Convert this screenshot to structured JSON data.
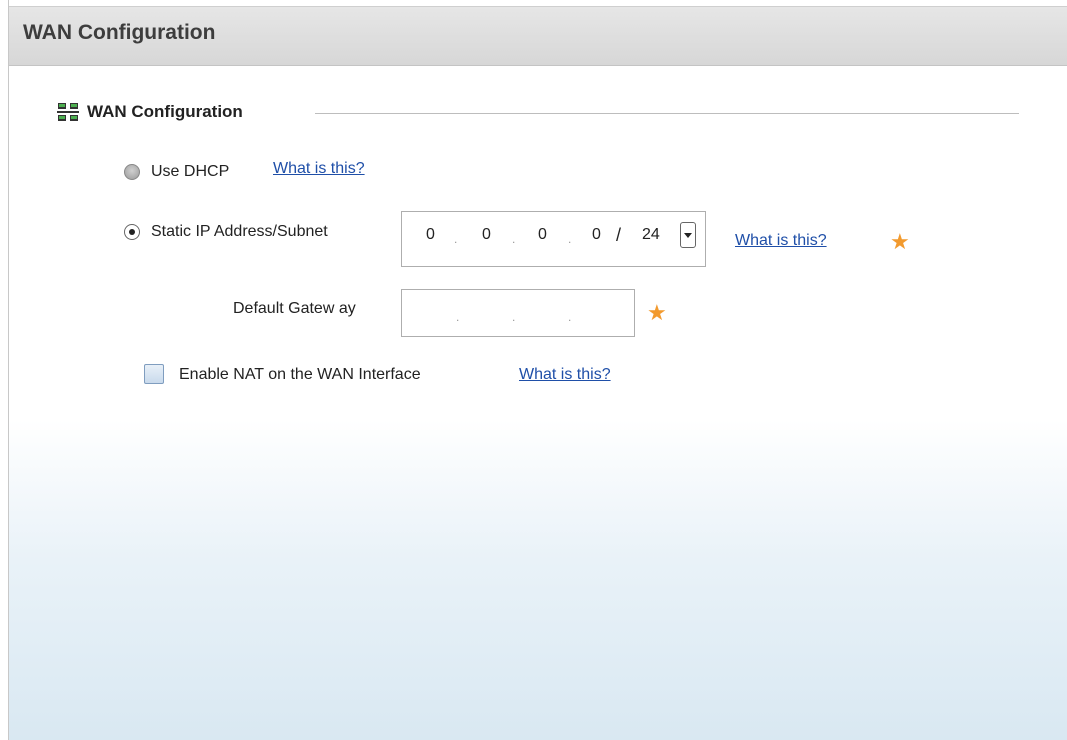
{
  "window": {
    "title": "WAN Configuration"
  },
  "section": {
    "title": "WAN Configuration",
    "icon": "network-icon"
  },
  "dhcp": {
    "label": "Use DHCP",
    "selected": false,
    "help_link": "What is this?"
  },
  "static_ip": {
    "label": "Static IP Address/Subnet",
    "selected": true,
    "octets": [
      "0",
      "0",
      "0",
      "0"
    ],
    "slash": "/",
    "mask": "24",
    "help_link": "What is this?",
    "required_mark": "★"
  },
  "gateway": {
    "label": "Default Gatew ay",
    "octets": [
      "",
      "",
      "",
      ""
    ],
    "required_mark": "★"
  },
  "nat": {
    "label": "Enable NAT on the WAN Interface",
    "checked": false,
    "help_link": "What is this?"
  },
  "colors": {
    "link": "#1f4fa8",
    "required": "#f29a2e",
    "titlebar": "#d9d9d9"
  }
}
